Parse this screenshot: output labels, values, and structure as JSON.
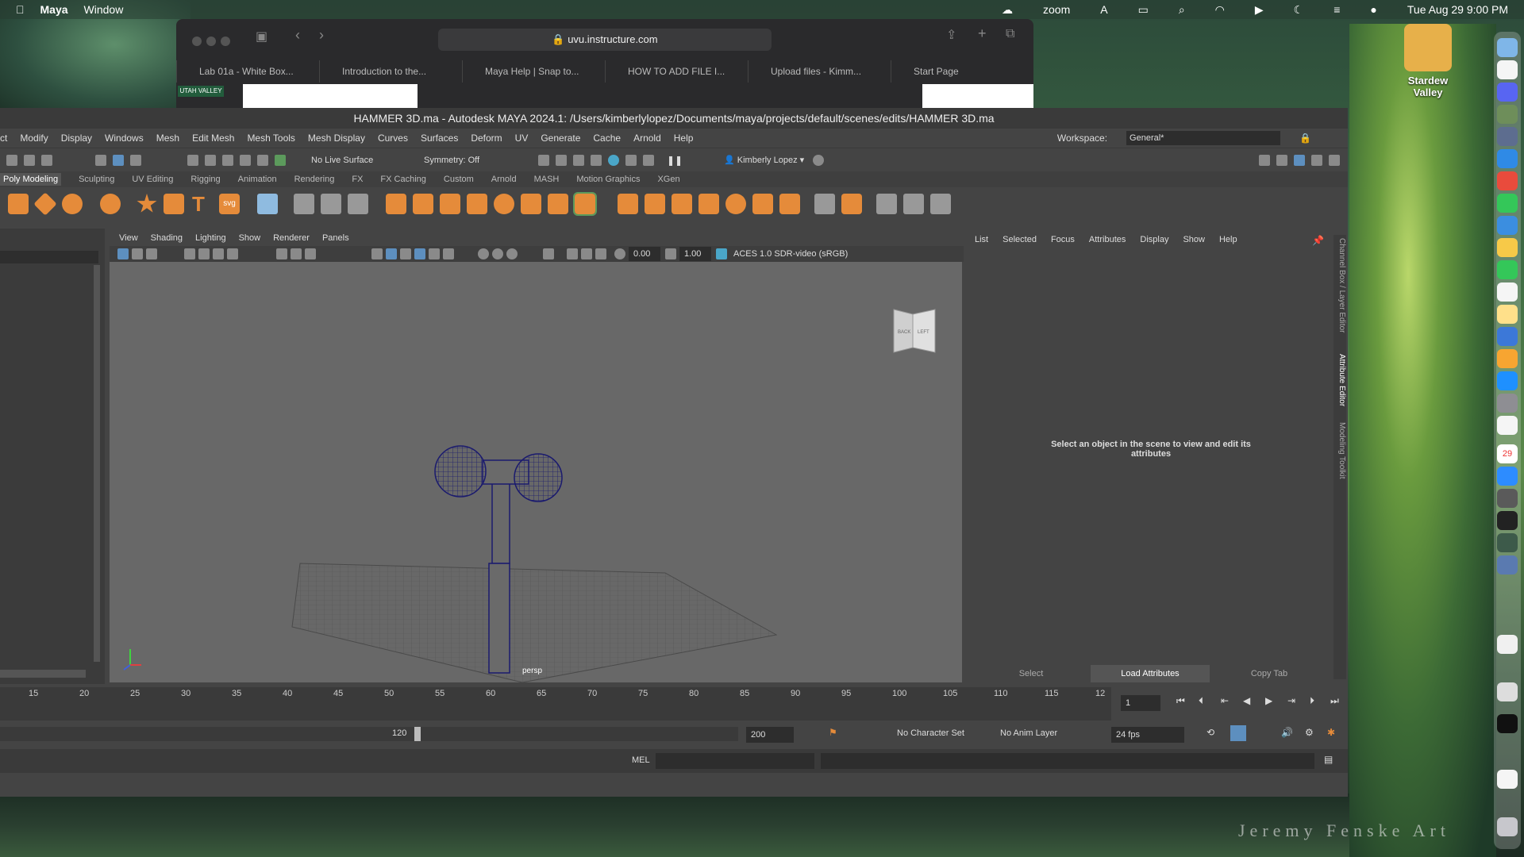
{
  "menubar": {
    "apple": "",
    "app": "Maya",
    "window": "Window",
    "zoom": "zoom",
    "datetime": "Tue Aug 29  9:00 PM"
  },
  "browser": {
    "url": "uvu.instructure.com",
    "tabs": [
      "Lab 01a - White Box...",
      "Introduction to the...",
      "Maya Help | Snap to...",
      "HOW TO ADD FILE I...",
      "Upload files - Kimm...",
      "Start Page"
    ],
    "page_strip": "UTAH VALLEY"
  },
  "maya": {
    "title": "HAMMER 3D.ma - Autodesk MAYA 2024.1: /Users/kimberlylopez/Documents/maya/projects/default/scenes/edits/HAMMER 3D.ma",
    "menus": [
      "ct",
      "Modify",
      "Display",
      "Windows",
      "Mesh",
      "Edit Mesh",
      "Mesh Tools",
      "Mesh Display",
      "Curves",
      "Surfaces",
      "Deform",
      "UV",
      "Generate",
      "Cache",
      "Arnold",
      "Help"
    ],
    "workspace_label": "Workspace:",
    "workspace_value": "General*",
    "status": {
      "live_surface": "No Live Surface",
      "symmetry": "Symmetry: Off",
      "user": "Kimberly Lopez"
    },
    "shelf_tabs": [
      "Poly Modeling",
      "Sculpting",
      "UV Editing",
      "Rigging",
      "Animation",
      "Rendering",
      "FX",
      "FX Caching",
      "Custom",
      "Arnold",
      "MASH",
      "Motion Graphics",
      "XGen"
    ],
    "shelf_text_glyphs": [
      "T",
      "svg"
    ],
    "viewport": {
      "menus": [
        "View",
        "Shading",
        "Lighting",
        "Show",
        "Renderer",
        "Panels"
      ],
      "exposure": "0.00",
      "gamma": "1.00",
      "color_space": "ACES 1.0 SDR-video (sRGB)",
      "camera": "persp",
      "viewcube_back": "BACK",
      "viewcube_left": "LEFT"
    },
    "attribute_editor": {
      "tabs": [
        "List",
        "Selected",
        "Focus",
        "Attributes",
        "Display",
        "Show",
        "Help"
      ],
      "message": "Select an object in the scene to view and edit its attributes",
      "buttons": [
        "Select",
        "Load Attributes",
        "Copy Tab"
      ],
      "side_tabs": [
        "Channel Box / Layer Editor",
        "Attribute Editor",
        "Modeling Toolkit"
      ]
    },
    "timeline": {
      "ticks": [
        "15",
        "20",
        "25",
        "30",
        "35",
        "40",
        "45",
        "50",
        "55",
        "60",
        "65",
        "70",
        "75",
        "80",
        "85",
        "90",
        "95",
        "100",
        "105",
        "110",
        "115",
        "12"
      ],
      "current_frame": "1"
    },
    "range": {
      "end": "120",
      "max": "200",
      "character_set": "No Character Set",
      "anim_layer": "No Anim Layer",
      "fps": "24 fps"
    },
    "cmd": {
      "label": "MEL"
    }
  },
  "desktop": {
    "icon_label": "Stardew Valley",
    "watermark": "Jeremy Fenske Art",
    "calendar_day": "29"
  },
  "colors": {
    "shelf_orange": "#e58b3a",
    "mesh_wire": "#1a1a6e",
    "viewport_bg": "#686868"
  }
}
